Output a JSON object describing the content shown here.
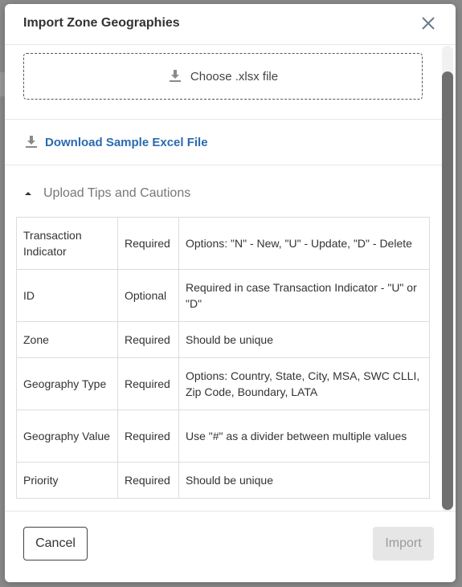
{
  "modal": {
    "title": "Import Zone Geographies"
  },
  "dropzone": {
    "label": "Choose .xlsx file"
  },
  "download": {
    "label": "Download Sample Excel File"
  },
  "tips": {
    "toggle_label": "Upload Tips and Cautions",
    "rows": [
      {
        "field": "Transaction Indicator",
        "requirement": "Required",
        "note": "Options: \"N\" - New, \"U\" - Update, \"D\" - Delete"
      },
      {
        "field": "ID",
        "requirement": "Optional",
        "note": "Required in case Transaction Indicator - \"U\" or \"D\""
      },
      {
        "field": "Zone",
        "requirement": "Required",
        "note": "Should be unique"
      },
      {
        "field": "Geography Type",
        "requirement": "Required",
        "note": "Options: Country, State, City, MSA, SWC CLLI, Zip Code, Boundary, LATA"
      },
      {
        "field": "Geography Value",
        "requirement": "Required",
        "note": "Use \"#\" as a divider between multiple values"
      },
      {
        "field": "Priority",
        "requirement": "Required",
        "note": "Should be unique"
      }
    ]
  },
  "footer": {
    "cancel_label": "Cancel",
    "import_label": "Import"
  },
  "colors": {
    "required": "#c0171a",
    "optional": "#f0a400",
    "link": "#2a6ab0"
  }
}
